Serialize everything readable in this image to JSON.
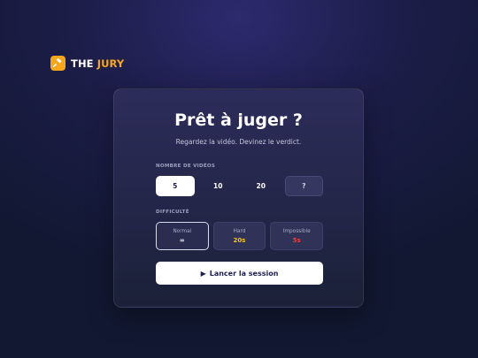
{
  "brand": {
    "word1": "THE",
    "word2": "JURY",
    "icon": "gavel-icon",
    "accent": "#f6a71c"
  },
  "card": {
    "title": "Prêt à juger ?",
    "subtitle": "Regardez la vidéo. Devinez le verdict."
  },
  "videos": {
    "label": "NOMBRE DE VIDÉOS",
    "options": [
      "5",
      "10",
      "20",
      "?"
    ],
    "selected": "5"
  },
  "difficulty": {
    "label": "DIFFICULTÉ",
    "options": [
      {
        "name": "Normal",
        "value": "∞",
        "color": "#ffffff"
      },
      {
        "name": "Hard",
        "value": "20s",
        "color": "#f6c21c"
      },
      {
        "name": "Impossible",
        "value": "5s",
        "color": "#ef3e3e"
      }
    ],
    "selected": "Normal"
  },
  "start_button": {
    "label": "Lancer la session",
    "icon": "play-icon"
  }
}
